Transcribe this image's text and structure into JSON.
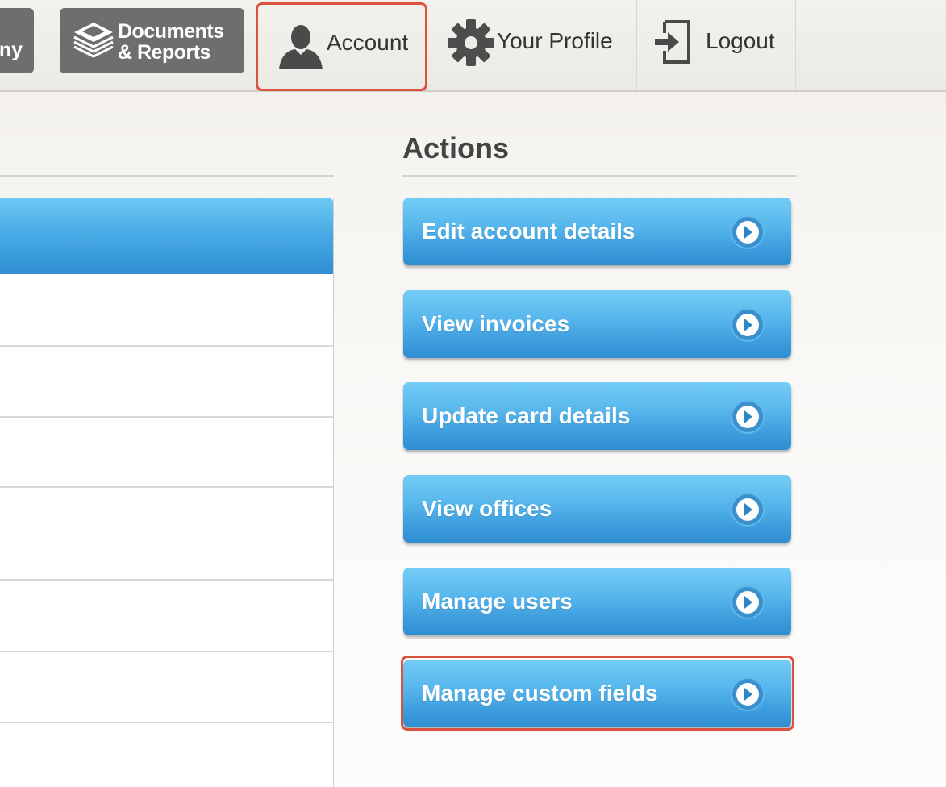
{
  "nav": {
    "company_label_partial": "ny",
    "documents_label": "Documents\n& Reports",
    "account_label": "Account",
    "profile_label": "Your Profile",
    "logout_label": "Logout"
  },
  "actions": {
    "title": "Actions",
    "buttons": [
      {
        "label": "Edit account details"
      },
      {
        "label": "View invoices"
      },
      {
        "label": "Update card details"
      },
      {
        "label": "View offices"
      },
      {
        "label": "Manage users"
      },
      {
        "label": "Manage custom fields"
      }
    ]
  },
  "colors": {
    "button_blue": "#3d9ddd",
    "highlight_red": "#d9533f",
    "nav_dark": "#6e6e6e"
  },
  "icons": {
    "documents": "stack-of-documents-icon",
    "account": "person-silhouette-icon",
    "profile": "gear-icon",
    "logout": "logout-arrow-icon",
    "action_arrow": "circle-arrow-right-icon"
  }
}
